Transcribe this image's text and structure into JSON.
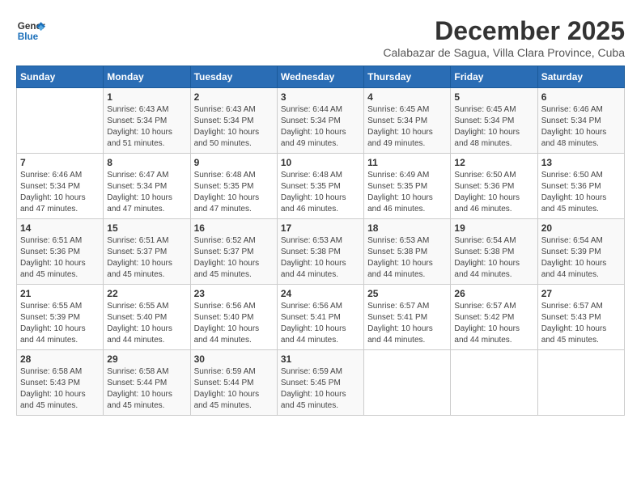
{
  "header": {
    "logo_general": "General",
    "logo_blue": "Blue",
    "month_title": "December 2025",
    "subtitle": "Calabazar de Sagua, Villa Clara Province, Cuba"
  },
  "days_of_week": [
    "Sunday",
    "Monday",
    "Tuesday",
    "Wednesday",
    "Thursday",
    "Friday",
    "Saturday"
  ],
  "weeks": [
    [
      {
        "day": "",
        "info": ""
      },
      {
        "day": "1",
        "info": "Sunrise: 6:43 AM\nSunset: 5:34 PM\nDaylight: 10 hours\nand 51 minutes."
      },
      {
        "day": "2",
        "info": "Sunrise: 6:43 AM\nSunset: 5:34 PM\nDaylight: 10 hours\nand 50 minutes."
      },
      {
        "day": "3",
        "info": "Sunrise: 6:44 AM\nSunset: 5:34 PM\nDaylight: 10 hours\nand 49 minutes."
      },
      {
        "day": "4",
        "info": "Sunrise: 6:45 AM\nSunset: 5:34 PM\nDaylight: 10 hours\nand 49 minutes."
      },
      {
        "day": "5",
        "info": "Sunrise: 6:45 AM\nSunset: 5:34 PM\nDaylight: 10 hours\nand 48 minutes."
      },
      {
        "day": "6",
        "info": "Sunrise: 6:46 AM\nSunset: 5:34 PM\nDaylight: 10 hours\nand 48 minutes."
      }
    ],
    [
      {
        "day": "7",
        "info": "Sunrise: 6:46 AM\nSunset: 5:34 PM\nDaylight: 10 hours\nand 47 minutes."
      },
      {
        "day": "8",
        "info": "Sunrise: 6:47 AM\nSunset: 5:34 PM\nDaylight: 10 hours\nand 47 minutes."
      },
      {
        "day": "9",
        "info": "Sunrise: 6:48 AM\nSunset: 5:35 PM\nDaylight: 10 hours\nand 47 minutes."
      },
      {
        "day": "10",
        "info": "Sunrise: 6:48 AM\nSunset: 5:35 PM\nDaylight: 10 hours\nand 46 minutes."
      },
      {
        "day": "11",
        "info": "Sunrise: 6:49 AM\nSunset: 5:35 PM\nDaylight: 10 hours\nand 46 minutes."
      },
      {
        "day": "12",
        "info": "Sunrise: 6:50 AM\nSunset: 5:36 PM\nDaylight: 10 hours\nand 46 minutes."
      },
      {
        "day": "13",
        "info": "Sunrise: 6:50 AM\nSunset: 5:36 PM\nDaylight: 10 hours\nand 45 minutes."
      }
    ],
    [
      {
        "day": "14",
        "info": "Sunrise: 6:51 AM\nSunset: 5:36 PM\nDaylight: 10 hours\nand 45 minutes."
      },
      {
        "day": "15",
        "info": "Sunrise: 6:51 AM\nSunset: 5:37 PM\nDaylight: 10 hours\nand 45 minutes."
      },
      {
        "day": "16",
        "info": "Sunrise: 6:52 AM\nSunset: 5:37 PM\nDaylight: 10 hours\nand 45 minutes."
      },
      {
        "day": "17",
        "info": "Sunrise: 6:53 AM\nSunset: 5:38 PM\nDaylight: 10 hours\nand 44 minutes."
      },
      {
        "day": "18",
        "info": "Sunrise: 6:53 AM\nSunset: 5:38 PM\nDaylight: 10 hours\nand 44 minutes."
      },
      {
        "day": "19",
        "info": "Sunrise: 6:54 AM\nSunset: 5:38 PM\nDaylight: 10 hours\nand 44 minutes."
      },
      {
        "day": "20",
        "info": "Sunrise: 6:54 AM\nSunset: 5:39 PM\nDaylight: 10 hours\nand 44 minutes."
      }
    ],
    [
      {
        "day": "21",
        "info": "Sunrise: 6:55 AM\nSunset: 5:39 PM\nDaylight: 10 hours\nand 44 minutes."
      },
      {
        "day": "22",
        "info": "Sunrise: 6:55 AM\nSunset: 5:40 PM\nDaylight: 10 hours\nand 44 minutes."
      },
      {
        "day": "23",
        "info": "Sunrise: 6:56 AM\nSunset: 5:40 PM\nDaylight: 10 hours\nand 44 minutes."
      },
      {
        "day": "24",
        "info": "Sunrise: 6:56 AM\nSunset: 5:41 PM\nDaylight: 10 hours\nand 44 minutes."
      },
      {
        "day": "25",
        "info": "Sunrise: 6:57 AM\nSunset: 5:41 PM\nDaylight: 10 hours\nand 44 minutes."
      },
      {
        "day": "26",
        "info": "Sunrise: 6:57 AM\nSunset: 5:42 PM\nDaylight: 10 hours\nand 44 minutes."
      },
      {
        "day": "27",
        "info": "Sunrise: 6:57 AM\nSunset: 5:43 PM\nDaylight: 10 hours\nand 45 minutes."
      }
    ],
    [
      {
        "day": "28",
        "info": "Sunrise: 6:58 AM\nSunset: 5:43 PM\nDaylight: 10 hours\nand 45 minutes."
      },
      {
        "day": "29",
        "info": "Sunrise: 6:58 AM\nSunset: 5:44 PM\nDaylight: 10 hours\nand 45 minutes."
      },
      {
        "day": "30",
        "info": "Sunrise: 6:59 AM\nSunset: 5:44 PM\nDaylight: 10 hours\nand 45 minutes."
      },
      {
        "day": "31",
        "info": "Sunrise: 6:59 AM\nSunset: 5:45 PM\nDaylight: 10 hours\nand 45 minutes."
      },
      {
        "day": "",
        "info": ""
      },
      {
        "day": "",
        "info": ""
      },
      {
        "day": "",
        "info": ""
      }
    ]
  ]
}
